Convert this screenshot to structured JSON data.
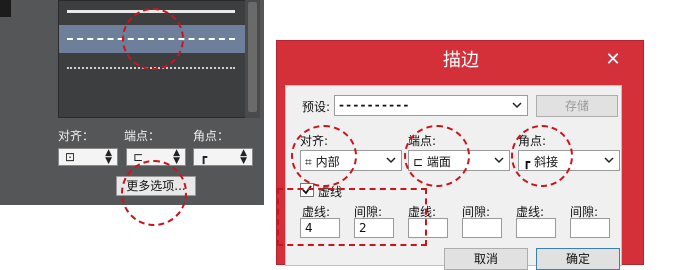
{
  "stroke_panel": {
    "align_label": "对齐：",
    "cap_label": "端点：",
    "corner_label": "角点：",
    "more_options_label": "更多选项..."
  },
  "stroke_dialog": {
    "title": "描边",
    "close_glyph": "✕",
    "preset_label": "预设:",
    "preset_value": "- - - - - - - - - -",
    "save_label": "存储",
    "align_label": "对齐:",
    "align_value": "内部",
    "cap_label": "端点:",
    "cap_value": "端面",
    "corner_label": "角点:",
    "corner_value": "斜接",
    "dashed_checkbox_label": "虚线",
    "dashed_checked": true,
    "dash_labels": [
      "虚线:",
      "间隙:",
      "虚线:",
      "间隙:",
      "虚线:",
      "间隙:"
    ],
    "dash_values": [
      "4",
      "2",
      "",
      "",
      "",
      ""
    ],
    "cancel_label": "取消",
    "ok_label": "确定"
  },
  "icons": {
    "align": "stroke-align-icon",
    "cap": "stroke-cap-icon",
    "corner": "stroke-corner-icon",
    "dropdown": "chevron-down-icon"
  },
  "colors": {
    "dialog_red": "#d4303a",
    "annotation_red": "#c8161d",
    "panel_dark": "#555657",
    "selected_row": "#6e7f9b"
  }
}
